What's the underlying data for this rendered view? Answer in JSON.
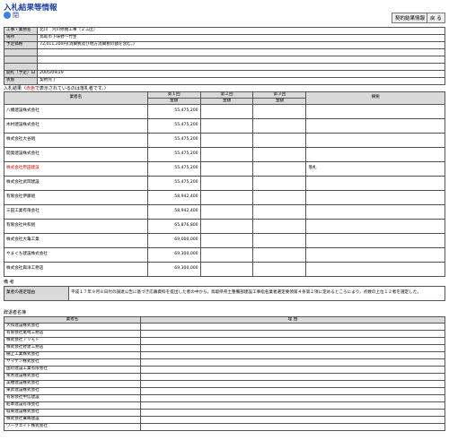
{
  "header": {
    "title": "入札結果等情報",
    "sub_label": "閉",
    "buttons": [
      "契約結果情報",
      "戻 る"
    ]
  },
  "info": [
    {
      "label": "工事・業務名",
      "value": "北川　河川修繕工事（２工区）"
    },
    {
      "label": "場所",
      "value": "鳥取市下味野～竹生"
    },
    {
      "label": "予定価格",
      "value": "72,011,200円(消費税及び地方消費税の額を含む。)"
    },
    {
      "label": "",
      "value": ""
    },
    {
      "label": "",
      "value": ""
    },
    {
      "label": "",
      "value": ""
    },
    {
      "label": "開札（予定）日",
      "value": "2005/09/29"
    },
    {
      "label": "状態",
      "value": "契約完了"
    }
  ],
  "bid_note": {
    "prefix": "入札結果（",
    "red": "赤色",
    "suffix": "で表示されているのは落札者です。）"
  },
  "bid_table": {
    "headers": {
      "name": "業者名",
      "r1": "第１回",
      "r2": "第２回",
      "r3": "第３回",
      "remarks": "摘要",
      "amount": "金額"
    },
    "rows": [
      {
        "name": "八幡建設株式会社",
        "amount": "55,475,200",
        "remark": "",
        "winner": false
      },
      {
        "name": "木村建設株式会社",
        "amount": "55,475,200",
        "remark": "",
        "winner": false
      },
      {
        "name": "株式会社大谷組",
        "amount": "55,475,200",
        "remark": "",
        "winner": false
      },
      {
        "name": "開発建設株式会社",
        "amount": "55,475,200",
        "remark": "",
        "winner": false
      },
      {
        "name": "株式会社原田建設",
        "amount": "55,475,200",
        "remark": "落札",
        "winner": true
      },
      {
        "name": "株式会社武岡建設",
        "amount": "55,475,200",
        "remark": "",
        "winner": false
      },
      {
        "name": "有限会社伊藤組",
        "amount": "58,942,400",
        "remark": "",
        "winner": false
      },
      {
        "name": "三田工業有限会社",
        "amount": "58,942,400",
        "remark": "",
        "winner": false
      },
      {
        "name": "有限会社共和組",
        "amount": "65,876,800",
        "remark": "",
        "winner": false
      },
      {
        "name": "株式会社大亀工業",
        "amount": "69,000,000",
        "remark": "",
        "winner": false
      },
      {
        "name": "やまぐち建設株式会社",
        "amount": "69,300,000",
        "remark": "",
        "winner": false
      },
      {
        "name": "株式会社興洋工務店",
        "amount": "69,300,000",
        "remark": "",
        "winner": false
      }
    ]
  },
  "remarks_section": {
    "heading": "備 考",
    "label": "業者の選定理由",
    "text": "平成１７年９月８日付の調達公告に基づき応募資料を提出した者の中から，鳥取県県土整備部建設工事指名業者選定要領第４条第２項に定めるところにより，点数の上位１２者を選定した。"
  },
  "decline": {
    "heading": "辞退者名簿",
    "headers": {
      "name": "業者名",
      "reason": "理 由"
    },
    "rows": [
      "大和建設株式会社",
      "有限会社尾崎工務店",
      "株式会社アリモト",
      "株式会社野建工務店",
      "樋上工業株式会社",
      "ヤマケン株式会社",
      "国府建設工業有限会社",
      "栄木建設株式会社",
      "美穂建設株式会社",
      "東昇建設株式会社",
      "有限会社中信建設",
      "船本建設有限会社",
      "城東建設株式会社",
      "株式会社鷲峰建設",
      "ワークエイト株式会社"
    ]
  }
}
